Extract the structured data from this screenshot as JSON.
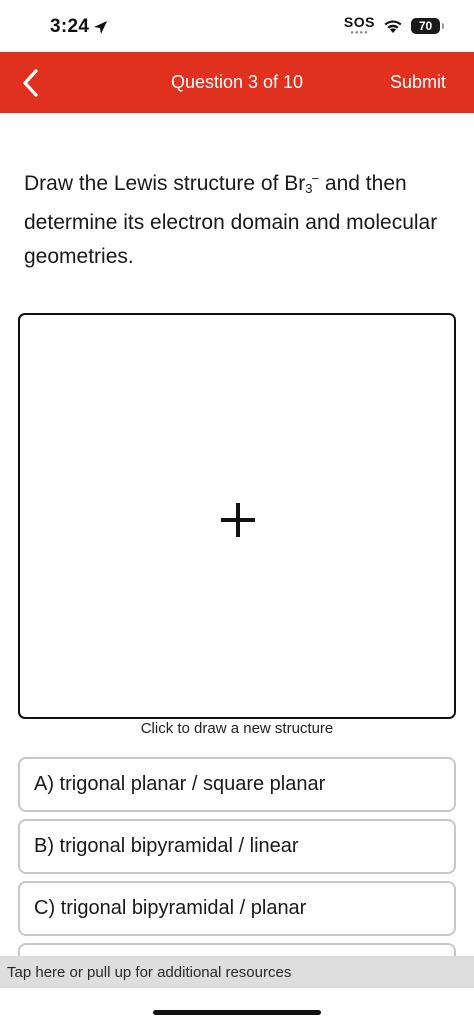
{
  "status_bar": {
    "time": "3:24",
    "sos": "SOS",
    "battery": "70"
  },
  "header": {
    "title": "Question 3 of 10",
    "submit_label": "Submit",
    "background_color": "#e0301e"
  },
  "question": {
    "text_before": "Draw the Lewis structure of Br",
    "subscript": "3",
    "superscript": "−",
    "text_after": " and then determine its electron domain and molecular geometries."
  },
  "drawing": {
    "caption": "Click to draw a new structure"
  },
  "options": [
    {
      "label": "A) trigonal planar / square planar"
    },
    {
      "label": "B) trigonal bipyramidal / linear"
    },
    {
      "label": "C) trigonal bipyramidal / planar"
    },
    {
      "label": ""
    }
  ],
  "resources_bar": {
    "text": "Tap here or pull up for additional resources"
  }
}
